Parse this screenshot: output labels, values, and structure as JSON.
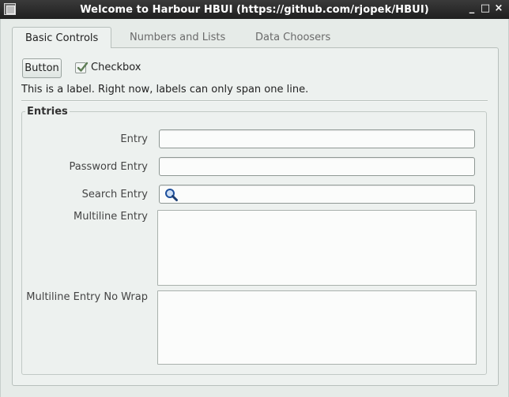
{
  "window": {
    "title": "Welcome to Harbour HBUI (https://github.com/rjopek/HBUI)",
    "minimize_glyph": "_",
    "maximize_glyph": "□",
    "close_glyph": "×"
  },
  "tabs": [
    {
      "label": "Basic Controls",
      "active": true
    },
    {
      "label": "Numbers and Lists",
      "active": false
    },
    {
      "label": "Data Choosers",
      "active": false
    }
  ],
  "basic_controls": {
    "button_label": "Button",
    "checkbox_label": "Checkbox",
    "checkbox_checked": true,
    "info_label": "This is a label. Right now, labels can only span one line."
  },
  "entries_group": {
    "title": "Entries",
    "fields": [
      {
        "label": "Entry",
        "value": ""
      },
      {
        "label": "Password Entry",
        "value": ""
      },
      {
        "label": "Search Entry",
        "value": ""
      },
      {
        "label": "Multiline Entry",
        "value": ""
      },
      {
        "label": "Multiline Entry No Wrap",
        "value": ""
      }
    ]
  },
  "colors": {
    "titlebar": "#2a2a2a",
    "window_bg": "#e6ebe8",
    "panel_bg": "#edf1ef",
    "search_icon": "#1d4f9c"
  },
  "icons": {
    "app": "app-icon",
    "checkbox": "check-icon",
    "search": "magnifier-icon"
  }
}
